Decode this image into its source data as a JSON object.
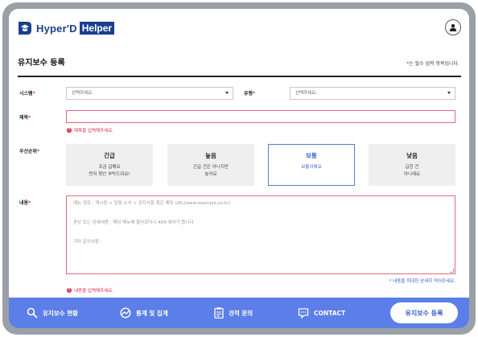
{
  "header": {
    "logo_text": "Hyper'D",
    "logo_badge": "Helper"
  },
  "page": {
    "title": "유지보수 등록",
    "required_note_star": "*",
    "required_note_text": "는 필수 입력 항목입니다."
  },
  "form": {
    "system": {
      "label": "시스템",
      "star": "*",
      "selected": "선택하세요."
    },
    "type": {
      "label": "유형",
      "star": "*",
      "selected": "선택하세요."
    },
    "subject": {
      "label": "제목",
      "star": "*",
      "value": "",
      "error": "제목을 입력해주세요."
    },
    "priority": {
      "label": "우선순위",
      "star": "*",
      "options": [
        {
          "name": "긴급",
          "desc1": "조금 급해요",
          "desc2": "먼저 확인 부탁드려요!"
        },
        {
          "name": "높음",
          "desc1": "긴급 건은 아니지만",
          "desc2": "높아요"
        },
        {
          "name": "보통",
          "desc1": "보통이에요",
          "desc2": ""
        },
        {
          "name": "낮음",
          "desc1": "급한 건",
          "desc2": "아니에요"
        }
      ],
      "selected": "보통"
    },
    "content": {
      "label": "내용",
      "star": "*",
      "placeholder_lines": [
        "메뉴 경로 : 게시판 > 알림·소식 > 공지사항 혹은 해당 URL(www.example.co.kr)",
        "증상 또는 상세내용 : 해당 메뉴에 들어갔더니 404 에러가 뜹니다.",
        "기타 문의사항 :"
      ],
      "hint": "* 내용을 최대한 상세히 적어주세요.",
      "error": "내용을 입력해주세요."
    }
  },
  "bottom_nav": {
    "items": [
      {
        "label": "유지보수 현황",
        "icon": "search-icon"
      },
      {
        "label": "통계 및 집계",
        "icon": "chart-icon"
      },
      {
        "label": "견적 문의",
        "icon": "document-icon"
      },
      {
        "label": "CONTACT",
        "icon": "chat-icon"
      }
    ],
    "cta": "유지보수 등록"
  },
  "colors": {
    "brand": "#1b3f8f",
    "accent": "#5b7ee8",
    "error": "#e0284a"
  }
}
